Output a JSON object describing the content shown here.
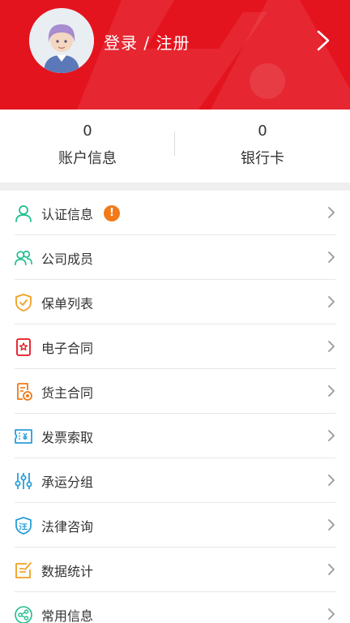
{
  "header": {
    "login_label": "登录 / 注册",
    "bg_color": "#e4141f",
    "avatar_icon": "user-avatar-icon",
    "chevron_icon": "chevron-right-icon"
  },
  "stats": [
    {
      "value": "0",
      "label": "账户信息"
    },
    {
      "value": "0",
      "label": "银行卡"
    }
  ],
  "menu": {
    "items": [
      {
        "label": "认证信息",
        "icon": "user-verify-icon",
        "badge": "!"
      },
      {
        "label": "公司成员",
        "icon": "members-icon"
      },
      {
        "label": "保单列表",
        "icon": "insurance-shield-icon"
      },
      {
        "label": "电子合同",
        "icon": "e-contract-icon"
      },
      {
        "label": "货主合同",
        "icon": "shipper-contract-icon"
      },
      {
        "label": "发票索取",
        "icon": "invoice-icon"
      },
      {
        "label": "承运分组",
        "icon": "sliders-icon"
      },
      {
        "label": "法律咨询",
        "icon": "legal-shield-icon"
      },
      {
        "label": "数据统计",
        "icon": "statistics-icon"
      },
      {
        "label": "常用信息",
        "icon": "share-icon"
      }
    ]
  },
  "colors": {
    "accent_red": "#e4141f",
    "badge_orange": "#f27a1a",
    "icon_green": "#1dbf8e",
    "icon_orange": "#f0a020",
    "icon_blue": "#2a9fd8"
  }
}
